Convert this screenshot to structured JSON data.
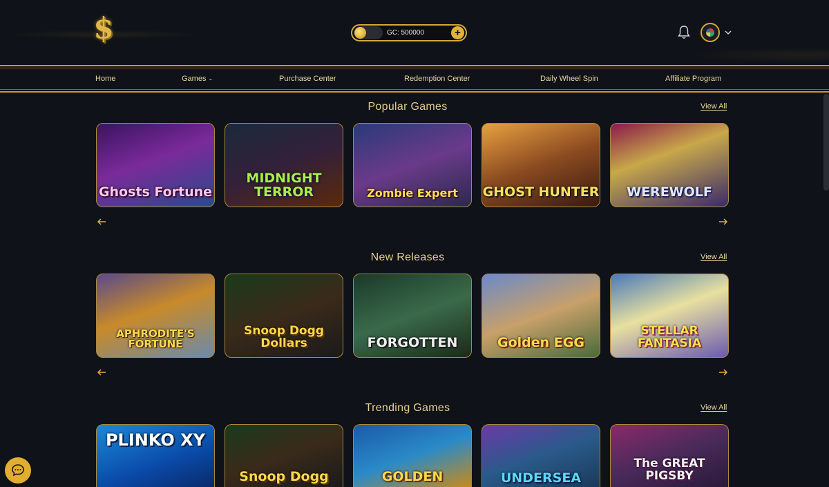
{
  "header": {
    "logo_glyph": "$",
    "gc_label": "GC: 500000",
    "plus_glyph": "+"
  },
  "nav": {
    "items": [
      "Home",
      "Games",
      "Purchase Center",
      "Redemption Center",
      "Daily Wheel Spin",
      "Affiliate Program"
    ]
  },
  "sections": [
    {
      "title": "Popular Games",
      "view_all": "View All",
      "cards": [
        "Ghosts Fortune",
        "MIDNIGHT TERROR",
        "Zombie Expert",
        "GHOST HUNTER",
        "WEREWOLF"
      ]
    },
    {
      "title": "New Releases",
      "view_all": "View All",
      "cards": [
        "APHRODITE'S FORTUNE",
        "Snoop Dogg Dollars",
        "FORGOTTEN",
        "Golden EGG",
        "STELLAR FANTASIA"
      ]
    },
    {
      "title": "Trending Games",
      "view_all": "View All",
      "cards": [
        "PLINKO XY",
        "Snoop Dogg",
        "GOLDEN",
        "UNDERSEA",
        "The GREAT PIGSBY"
      ]
    }
  ],
  "colors": {
    "background": "#0f1218",
    "gold": "#d4a938",
    "text_gold": "#e6cf93"
  }
}
